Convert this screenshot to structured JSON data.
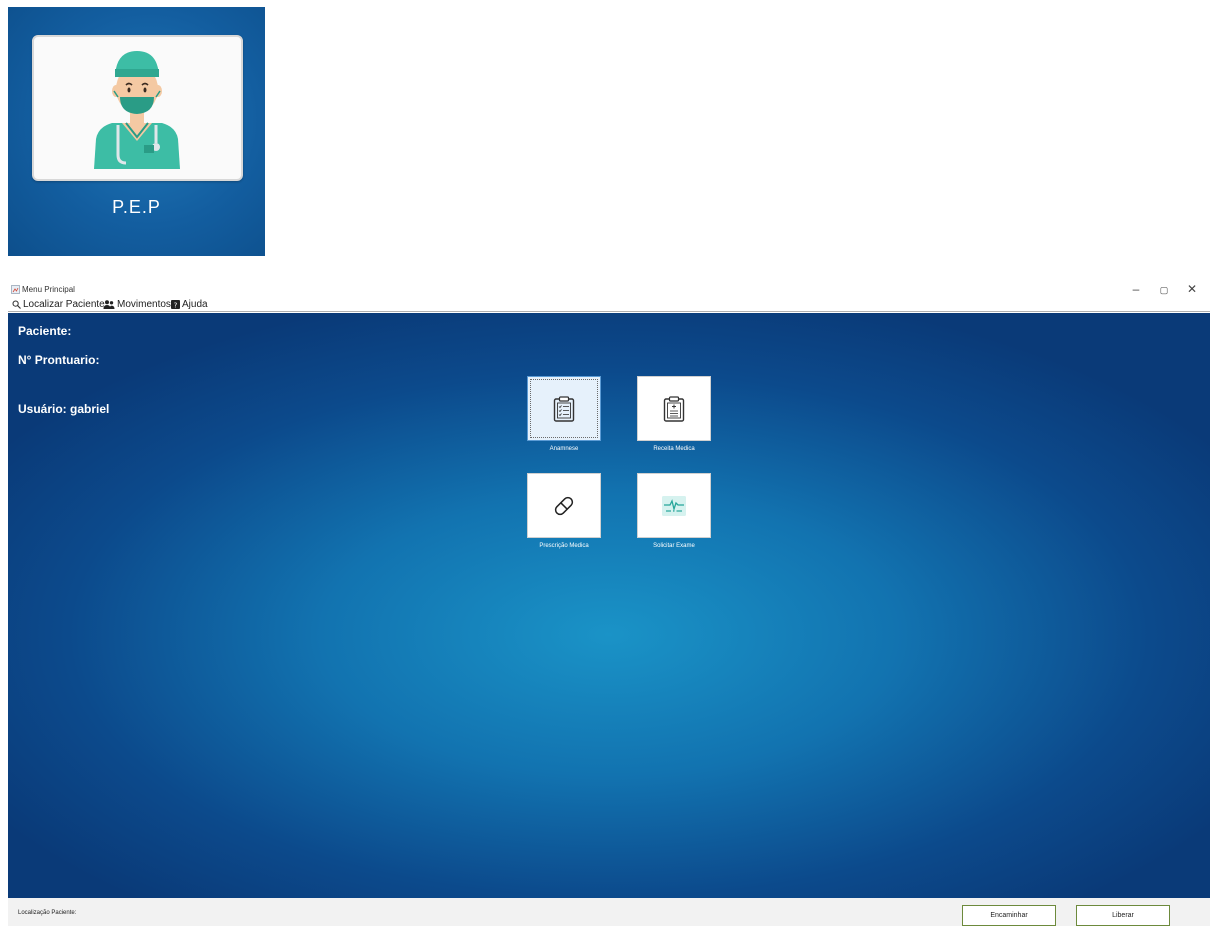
{
  "logo": {
    "text": "P.E.P",
    "icon": "doctor-avatar-icon"
  },
  "window": {
    "title": "Menu Principal",
    "controls": {
      "minimize": "–",
      "maximize": "▢",
      "close": "✕"
    }
  },
  "menu": {
    "items": [
      {
        "label": "Localizar Paciente",
        "icon": "search-icon"
      },
      {
        "label": "Movimentos",
        "icon": "users-icon"
      },
      {
        "label": "Ajuda",
        "icon": "help-icon"
      }
    ]
  },
  "info": {
    "paciente_label": "Paciente:",
    "prontuario_label": "N° Prontuario:",
    "usuario_label": "Usuário: gabriel"
  },
  "tiles": [
    {
      "label": "Anamnese",
      "icon": "clipboard-checklist-icon",
      "selected": true
    },
    {
      "label": "Receita Medica",
      "icon": "clipboard-medical-icon",
      "selected": false
    },
    {
      "label": "Prescrição Medica",
      "icon": "pill-capsule-icon",
      "selected": false
    },
    {
      "label": "Solicitar Exame",
      "icon": "heart-monitor-icon",
      "selected": false
    }
  ],
  "status": {
    "location_label": "Localização Paciente:"
  },
  "buttons": {
    "encaminhar": "Encaminhar",
    "liberar": "Liberar"
  },
  "colors": {
    "background_blue": "#1273b0",
    "button_border": "#6d8a3c"
  }
}
